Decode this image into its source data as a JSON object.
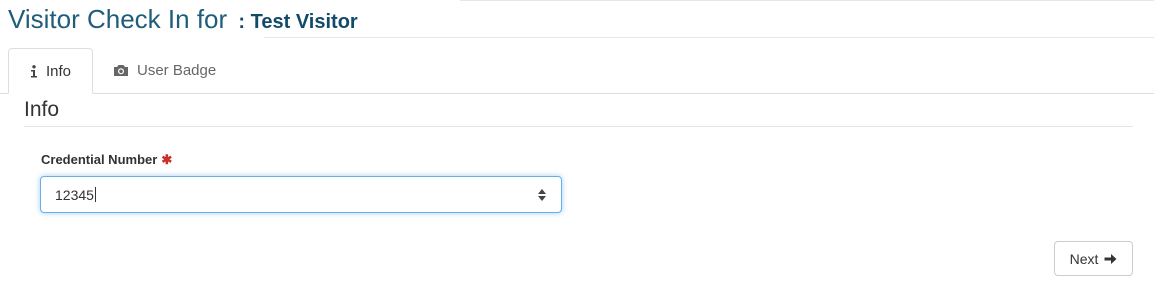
{
  "header": {
    "title_prefix": "Visitor Check In for",
    "visitor_name": ": Test Visitor"
  },
  "tabs": [
    {
      "label": "Info",
      "icon": "info-icon",
      "active": true
    },
    {
      "label": "User Badge",
      "icon": "camera-icon",
      "active": false
    }
  ],
  "section": {
    "title": "Info"
  },
  "form": {
    "credential_label": "Credential Number",
    "required_marker": "✱",
    "credential_value": "12345"
  },
  "actions": {
    "next_label": "Next",
    "next_icon": "arrow-right-icon"
  },
  "colors": {
    "title": "#1f5d7a",
    "visitor_name": "#124a6a",
    "required": "#c9302c",
    "focus_border": "#66afe9"
  }
}
